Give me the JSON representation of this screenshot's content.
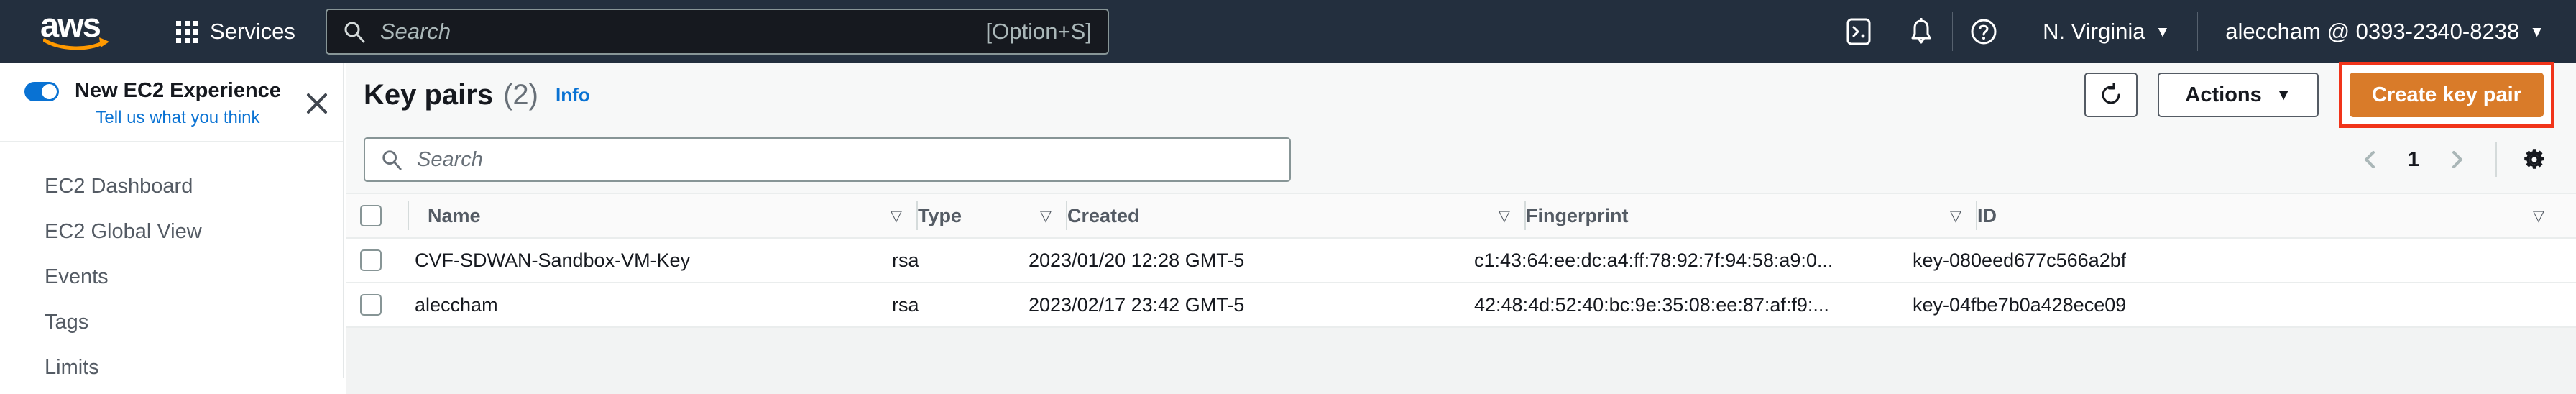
{
  "topnav": {
    "logo_text": "aws",
    "services_label": "Services",
    "search_placeholder": "Search",
    "search_shortcut": "[Option+S]",
    "cloudshell_icon": "cloudshell-icon",
    "bell_icon": "notifications-bell-icon",
    "help_icon": "help-question-icon",
    "region": "N. Virginia",
    "account": "aleccham @ 0393-2340-8238",
    "caret": "▼"
  },
  "sidebar": {
    "experience": {
      "title": "New EC2 Experience",
      "subtitle": "Tell us what you think",
      "toggle_on": true,
      "close_icon": "close-x-icon"
    },
    "items": [
      {
        "label": "EC2 Dashboard"
      },
      {
        "label": "EC2 Global View"
      },
      {
        "label": "Events"
      },
      {
        "label": "Tags"
      },
      {
        "label": "Limits"
      }
    ]
  },
  "main": {
    "title": "Key pairs",
    "count": "(2)",
    "info_label": "Info",
    "refresh_icon": "refresh-icon",
    "actions_label": "Actions",
    "actions_caret": "▼",
    "create_label": "Create key pair",
    "highlight_color": "#f1341a",
    "primary_color": "#d97b29",
    "search_placeholder": "Search",
    "pagination": {
      "prev_icon": "chevron-left-icon",
      "page": "1",
      "next_icon": "chevron-right-icon",
      "settings_icon": "gear-icon"
    },
    "table": {
      "columns": [
        {
          "label": "Name",
          "sort": "▽"
        },
        {
          "label": "Type",
          "sort": "▽"
        },
        {
          "label": "Created",
          "sort": "▽"
        },
        {
          "label": "Fingerprint",
          "sort": "▽"
        },
        {
          "label": "ID",
          "sort": "▽"
        }
      ],
      "rows": [
        {
          "name": "CVF-SDWAN-Sandbox-VM-Key",
          "type": "rsa",
          "created": "2023/01/20 12:28 GMT-5",
          "fingerprint": "c1:43:64:ee:dc:a4:ff:78:92:7f:94:58:a9:0...",
          "id": "key-080eed677c566a2bf"
        },
        {
          "name": "aleccham",
          "type": "rsa",
          "created": "2023/02/17 23:42 GMT-5",
          "fingerprint": "42:48:4d:52:40:bc:9e:35:08:ee:87:af:f9:...",
          "id": "key-04fbe7b0a428ece09"
        }
      ]
    }
  }
}
